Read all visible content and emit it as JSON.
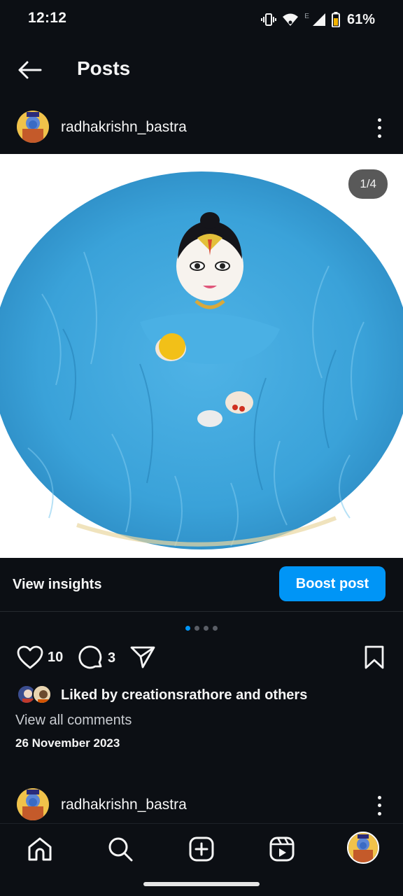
{
  "status": {
    "time": "12:12",
    "network_label": "E",
    "battery": "61%",
    "icons": [
      "vibrate-icon",
      "wifi-icon",
      "signal-icon",
      "battery-icon"
    ]
  },
  "header": {
    "title": "Posts",
    "back_icon": "arrow-left-icon"
  },
  "post": {
    "username": "radhakrishn_bastra",
    "image_counter": "1/4",
    "carousel": {
      "total": 4,
      "active": 1
    },
    "insights_label": "View insights",
    "boost_label": "Boost post",
    "likes_count": "10",
    "comments_count": "3",
    "liked_by_text": "Liked by creationsrathore and others",
    "view_comments_label": "View all comments",
    "date": "26 November 2023"
  },
  "next_post": {
    "username": "radhakrishn_bastra"
  },
  "colors": {
    "background": "#0c0f14",
    "accent": "#0095f6",
    "fur_blue": "#3fa9e0"
  },
  "nav": {
    "items": [
      "home-icon",
      "search-icon",
      "create-icon",
      "reels-icon",
      "profile-avatar"
    ]
  }
}
